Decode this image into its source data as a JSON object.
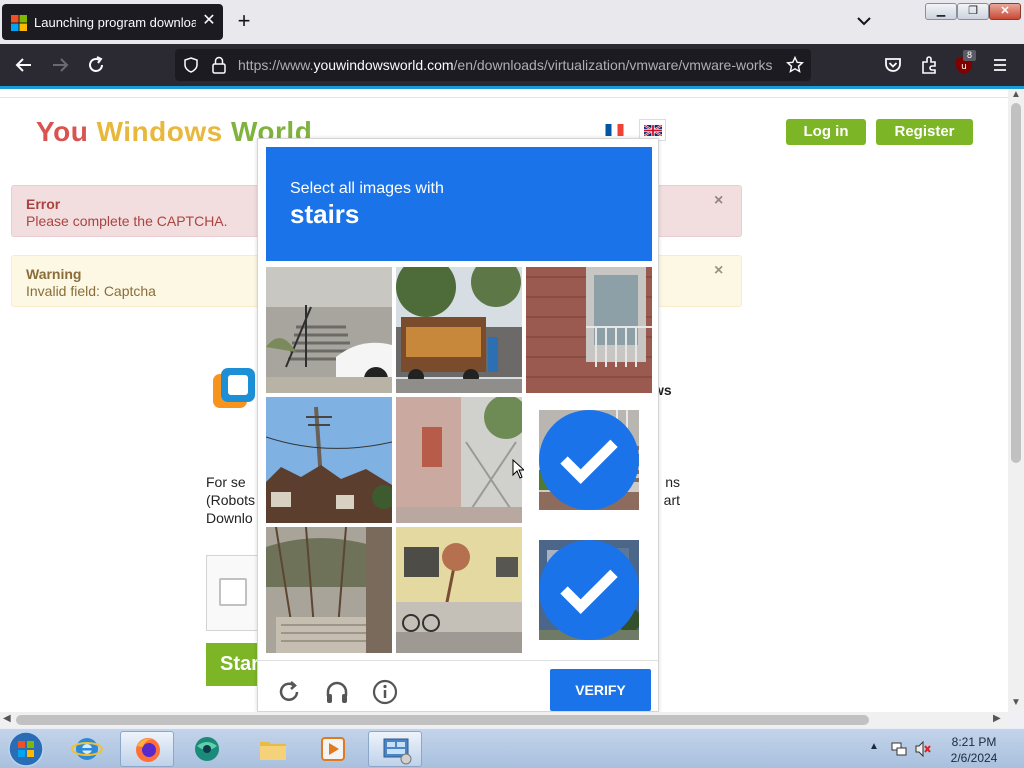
{
  "browser": {
    "tab_title": "Launching program download",
    "url_prefix": "https://www.",
    "url_domain": "youwindowsworld.com",
    "url_path": "/en/downloads/virtualization/vmware/vmware-works",
    "extension_badge": "8"
  },
  "site": {
    "logo": {
      "you": "You ",
      "windows": "Windows ",
      "world": "World"
    },
    "login_label": "Log in",
    "register_label": "Register",
    "error": {
      "title": "Error",
      "message": "Please complete the CAPTCHA.",
      "close": "×"
    },
    "warning": {
      "title": "Warning",
      "message": "Invalid field: Captcha",
      "close": "×"
    },
    "product_fragment": "ws",
    "para_left": [
      "For se",
      "(Robots",
      "Downlo"
    ],
    "para_right": [
      "ns",
      "art"
    ],
    "start_label": "Star"
  },
  "captcha": {
    "instruction": "Select all images with",
    "target": "stairs",
    "verify_label": "VERIFY",
    "tiles": [
      {
        "subject": "stairs by a car",
        "selected": false
      },
      {
        "subject": "street market truck",
        "selected": false
      },
      {
        "subject": "balcony on red wall",
        "selected": false
      },
      {
        "subject": "utility pole and houses",
        "selected": false
      },
      {
        "subject": "door on pink wall",
        "selected": false
      },
      {
        "subject": "potted palm by stairs",
        "selected": true
      },
      {
        "subject": "vine covered wall",
        "selected": false
      },
      {
        "subject": "yellow house with bikes",
        "selected": false
      },
      {
        "subject": "porch stairs",
        "selected": true
      }
    ]
  },
  "taskbar": {
    "time": "8:21 PM",
    "date": "2/6/2024"
  }
}
